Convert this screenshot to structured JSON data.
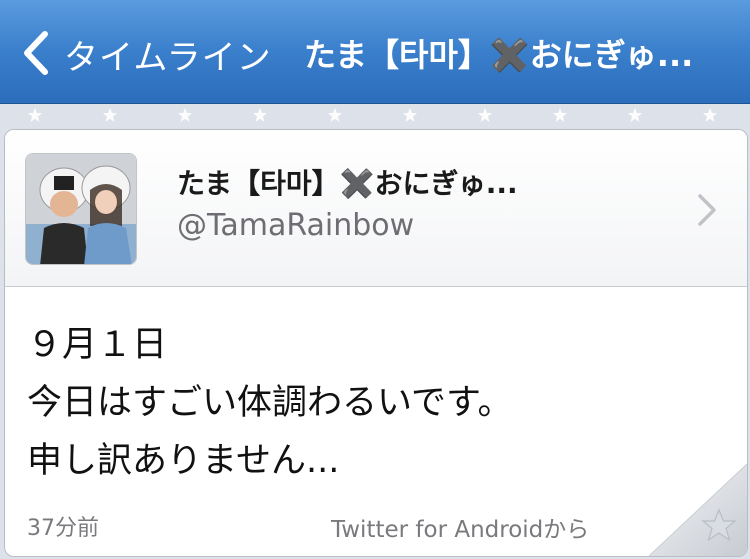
{
  "navbar": {
    "back_label": "タイムライン",
    "title": "たま【타마】✖️おにぎゅ..."
  },
  "tweet": {
    "user_name": "たま【타마】✖️おにぎゅ...",
    "user_handle": "@TamaRainbow",
    "lines": [
      "９月１日",
      "今日はすごい体調わるいです。",
      "申し訳ありません..."
    ],
    "time": "37分前",
    "source": "Twitter for Androidから"
  },
  "icons": {
    "back": "chevron-left-icon",
    "disclosure": "chevron-right-icon",
    "favorite": "star-icon"
  },
  "colors": {
    "navbar": "#3a7fcc",
    "background": "#dde2ea",
    "card": "#ffffff",
    "meta_text": "#7a7a7e"
  }
}
